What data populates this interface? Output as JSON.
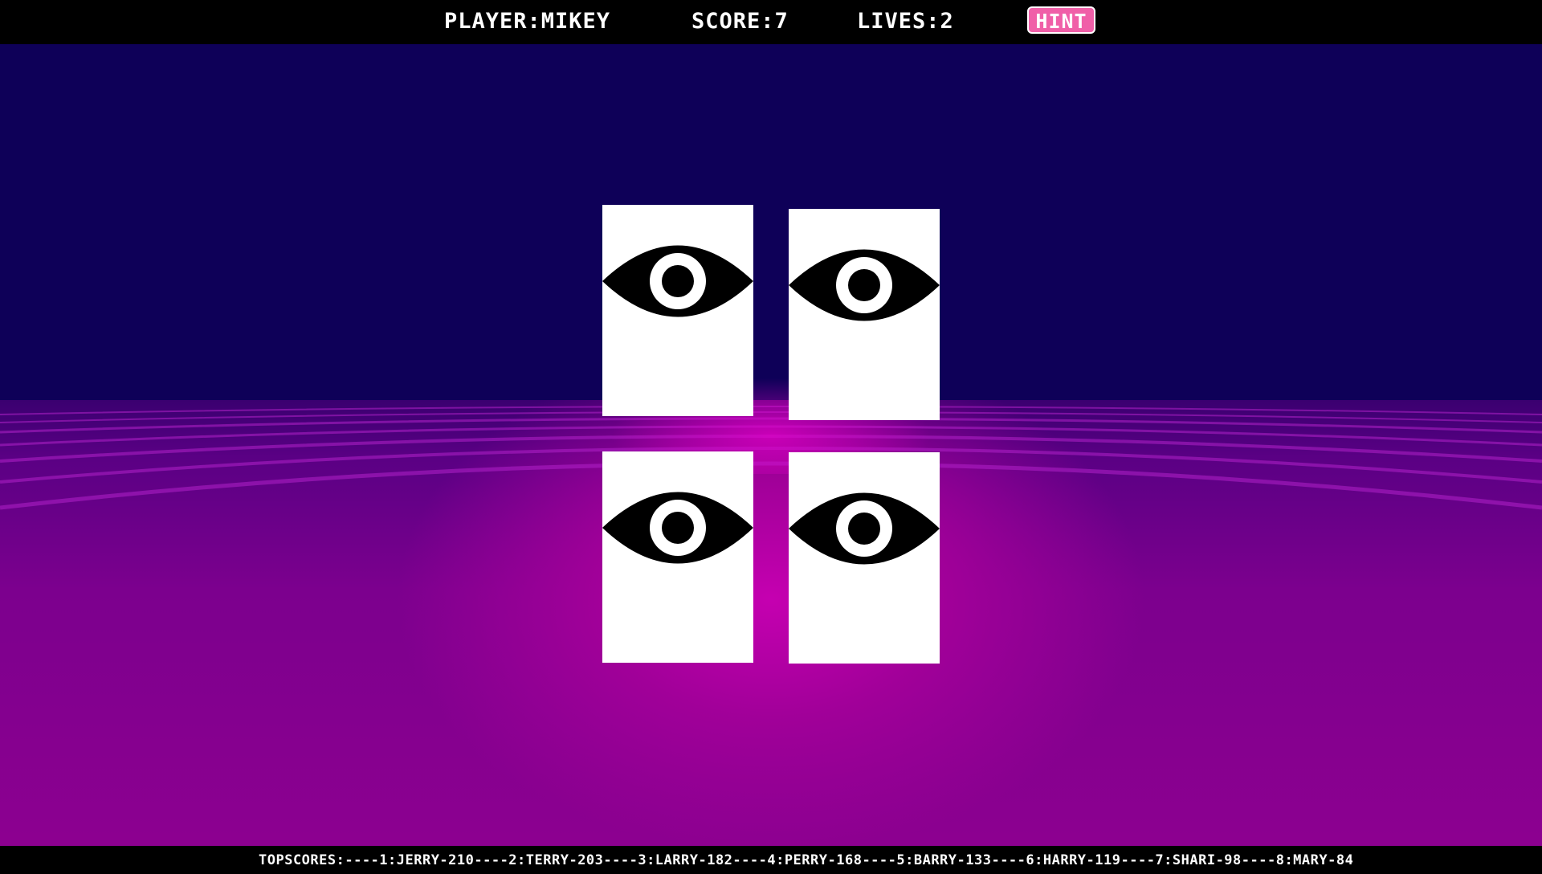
{
  "hud": {
    "player": "PLAYER:MIKEY",
    "score": "SCORE:7",
    "lives": "LIVES:2",
    "hint_label": "HINT"
  },
  "colors": {
    "sky": "#0e0058",
    "floor": "#8e0090",
    "glow": "#c500b0",
    "hint_button": "#f05fa8",
    "card": "#ffffff",
    "eye": "#000000"
  },
  "cards": [
    {
      "icon": "eye-icon"
    },
    {
      "icon": "eye-icon"
    },
    {
      "icon": "eye-icon"
    },
    {
      "icon": "eye-icon"
    }
  ],
  "ticker": {
    "text": "TOPSCORES:----1:JERRY-210----2:TERRY-203----3:LARRY-182----4:PERRY-168----5:BARRY-133----6:HARRY-119----7:SHARI-98----8:MARY-84"
  }
}
